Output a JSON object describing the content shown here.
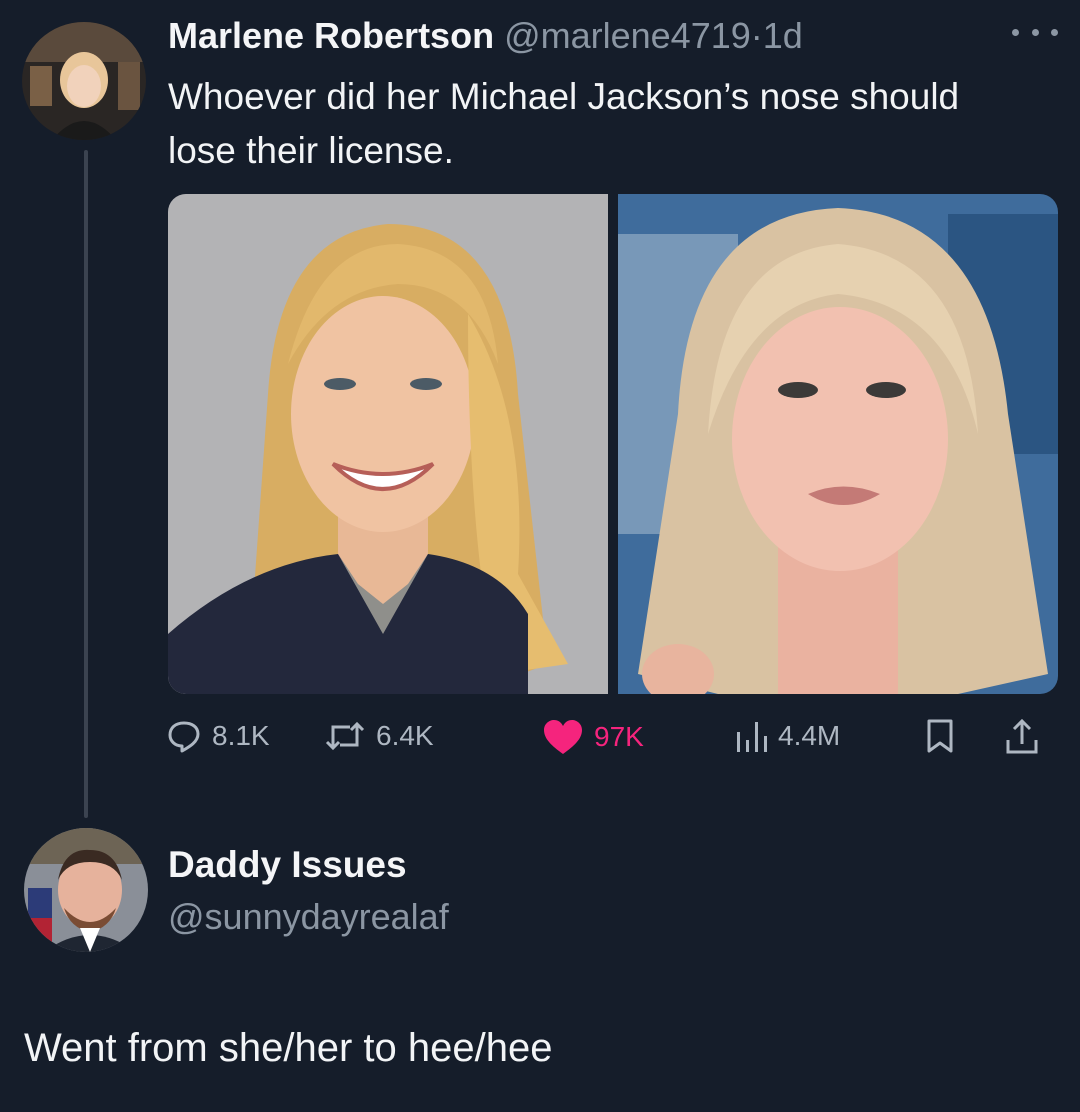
{
  "tweet": {
    "author_name": "Marlene Robertson",
    "author_handle": "@marlene4719",
    "separator": "·",
    "time": "1d",
    "text": "Whoever did her Michael Jackson’s nose should lose their license.",
    "stats": {
      "replies": "8.1K",
      "retweets": "6.4K",
      "likes": "97K",
      "views": "4.4M"
    },
    "like_color": "#f5247d"
  },
  "reply": {
    "author_name": "Daddy Issues",
    "author_handle": "@sunnydayrealaf",
    "text": "Went from she/her to hee/hee"
  },
  "icons": {
    "more": "more-options-icon",
    "reply": "reply-bubble-icon",
    "retweet": "retweet-icon",
    "like": "heart-icon",
    "views": "views-bars-icon",
    "bookmark": "bookmark-icon",
    "share": "share-upload-icon"
  },
  "colors": {
    "background": "#151d2a",
    "muted_text": "#8b96a3",
    "thread_line": "#3b4350"
  }
}
